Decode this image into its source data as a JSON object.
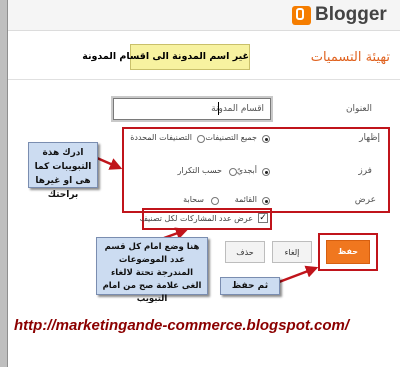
{
  "header": {
    "logo_text": "Blogger"
  },
  "page": {
    "title": "تهيئة التسميات",
    "note": "غير اسم المدونة الى اقسام المدونة"
  },
  "form": {
    "title_label": "العنوان",
    "title_value": "اقسام المدونة",
    "show_label": "إظهار",
    "show_options": [
      "جميع التصنيفات",
      "التصنيفات المحددة"
    ],
    "sort_label": "فرز",
    "sort_options": [
      "أبجديً",
      "حسب التكرار"
    ],
    "display_label": "عرض",
    "display_options": [
      "القائمة",
      "سحابة"
    ],
    "count_label": "عرض عدد المشاركات لكل تصنيف",
    "save_label": "حفظ",
    "cancel_label": "إلغاء",
    "delete_label": "حذف"
  },
  "annotations": {
    "callout_options": "ادرك هذة التبويبات كما هى او غيرها براحتك",
    "callout_count": "هنا وضع امام كل قسم عدد الموضوعات المندرجة تحتة لالغاء الغى علامة صح من امام التبويب",
    "callout_save": "ثم حفظ",
    "url": "http://marketingande-commerce.blogspot.com/"
  },
  "colors": {
    "accent": "#f0771f",
    "annotation_red": "#c0141b",
    "callout_bg": "#ccdcf1",
    "note_bg": "#f7f2a0"
  }
}
